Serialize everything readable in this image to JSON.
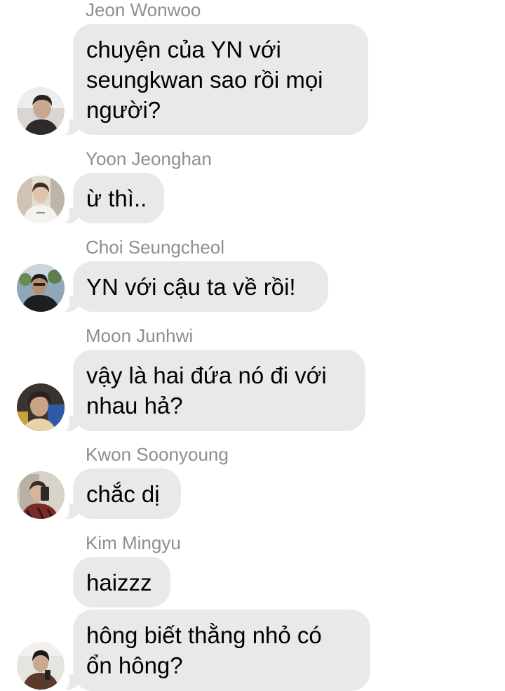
{
  "conversation": {
    "messages": [
      {
        "sender": "Jeon Wonwoo",
        "text": "chuyện của YN với\nseungkwan sao rồi mọi\nngười?",
        "avatar": "avatar-wonwoo"
      },
      {
        "sender": "Yoon Jeonghan",
        "text": "ừ thì..",
        "avatar": "avatar-jeonghan"
      },
      {
        "sender": "Choi Seungcheol",
        "text": "YN với cậu ta về rồi!",
        "avatar": "avatar-seungcheol"
      },
      {
        "sender": "Moon Junhwi",
        "text": "vậy là hai đứa nó đi với\nnhau hả?",
        "avatar": "avatar-junhwi"
      },
      {
        "sender": "Kwon Soonyoung",
        "text": "chắc dị",
        "avatar": "avatar-soonyoung"
      },
      {
        "sender": "Kim Mingyu",
        "text": "haizzz",
        "avatar": null
      },
      {
        "sender": null,
        "text": "hông biết thằng nhỏ có\nổn hông?",
        "avatar": "avatar-mingyu"
      }
    ]
  },
  "colors": {
    "bubble_background": "#e9e9eb",
    "sender_name": "#8e8e93",
    "message_text": "#000000",
    "background": "#ffffff"
  }
}
